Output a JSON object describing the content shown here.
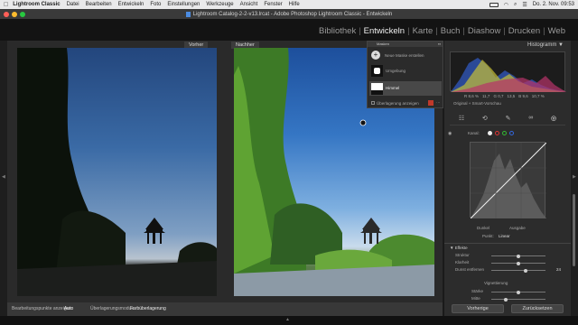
{
  "menubar": {
    "app": "Lightroom Classic",
    "items": [
      "Datei",
      "Bearbeiten",
      "Entwickeln",
      "Foto",
      "Einstellungen",
      "Werkzeuge",
      "Ansicht",
      "Fenster",
      "Hilfe"
    ],
    "clock": "Do. 2. Nov. 09:53"
  },
  "window": {
    "title": "Lightroom Catalog-2-2-v13.lrcat - Adobe Photoshop Lightroom Classic - Entwickeln"
  },
  "modules": [
    "Bibliothek",
    "Entwickeln",
    "Karte",
    "Buch",
    "Diashow",
    "Drucken",
    "Web"
  ],
  "active_module": "Entwickeln",
  "view": {
    "before_label": "Vorher",
    "after_label": "Nachher"
  },
  "masks": {
    "title": "Masken",
    "new_mask": "Neue Maske erstellen",
    "items": [
      "Umgebung",
      "Himmel"
    ],
    "overlay_label": "Überlagerung anzeigen"
  },
  "histogram": {
    "title": "Histogramm",
    "readout": [
      "R 8,6 %",
      "11,7",
      "G 0,7",
      "13,5",
      "B 9,6",
      "10,7 %"
    ],
    "info": "Original + Smart-Vorschau"
  },
  "tone_curve": {
    "label": "Kanal:",
    "region_left": "Dunkel",
    "region_right": "Ausgabe",
    "point_label": "Punkt:",
    "point_value": "Linear"
  },
  "effects": {
    "title": "Effekte",
    "sliders": [
      {
        "label": "Struktur",
        "value": ""
      },
      {
        "label": "Klarheit",
        "value": ""
      },
      {
        "label": "Dunst entfernen",
        "value": "24"
      }
    ],
    "vignette_title": "Vignettierung",
    "vignette_sliders": [
      {
        "label": "Stärke",
        "value": ""
      },
      {
        "label": "Mitte",
        "value": ""
      }
    ]
  },
  "bottombar": {
    "edit_points_label": "Bearbeitungspunkte anzeigen:",
    "edit_points_value": "Auto",
    "overlay_mode_label": "Überlagerungsmodus:",
    "overlay_mode_value": "Farbüberlagerung"
  },
  "buttons": {
    "previous": "Vorherige",
    "reset": "Zurücksetzen"
  },
  "colors": {
    "accent": "#ffffff",
    "sky_top": "#2f5fa8",
    "sky_bottom": "#8fb3d9"
  }
}
